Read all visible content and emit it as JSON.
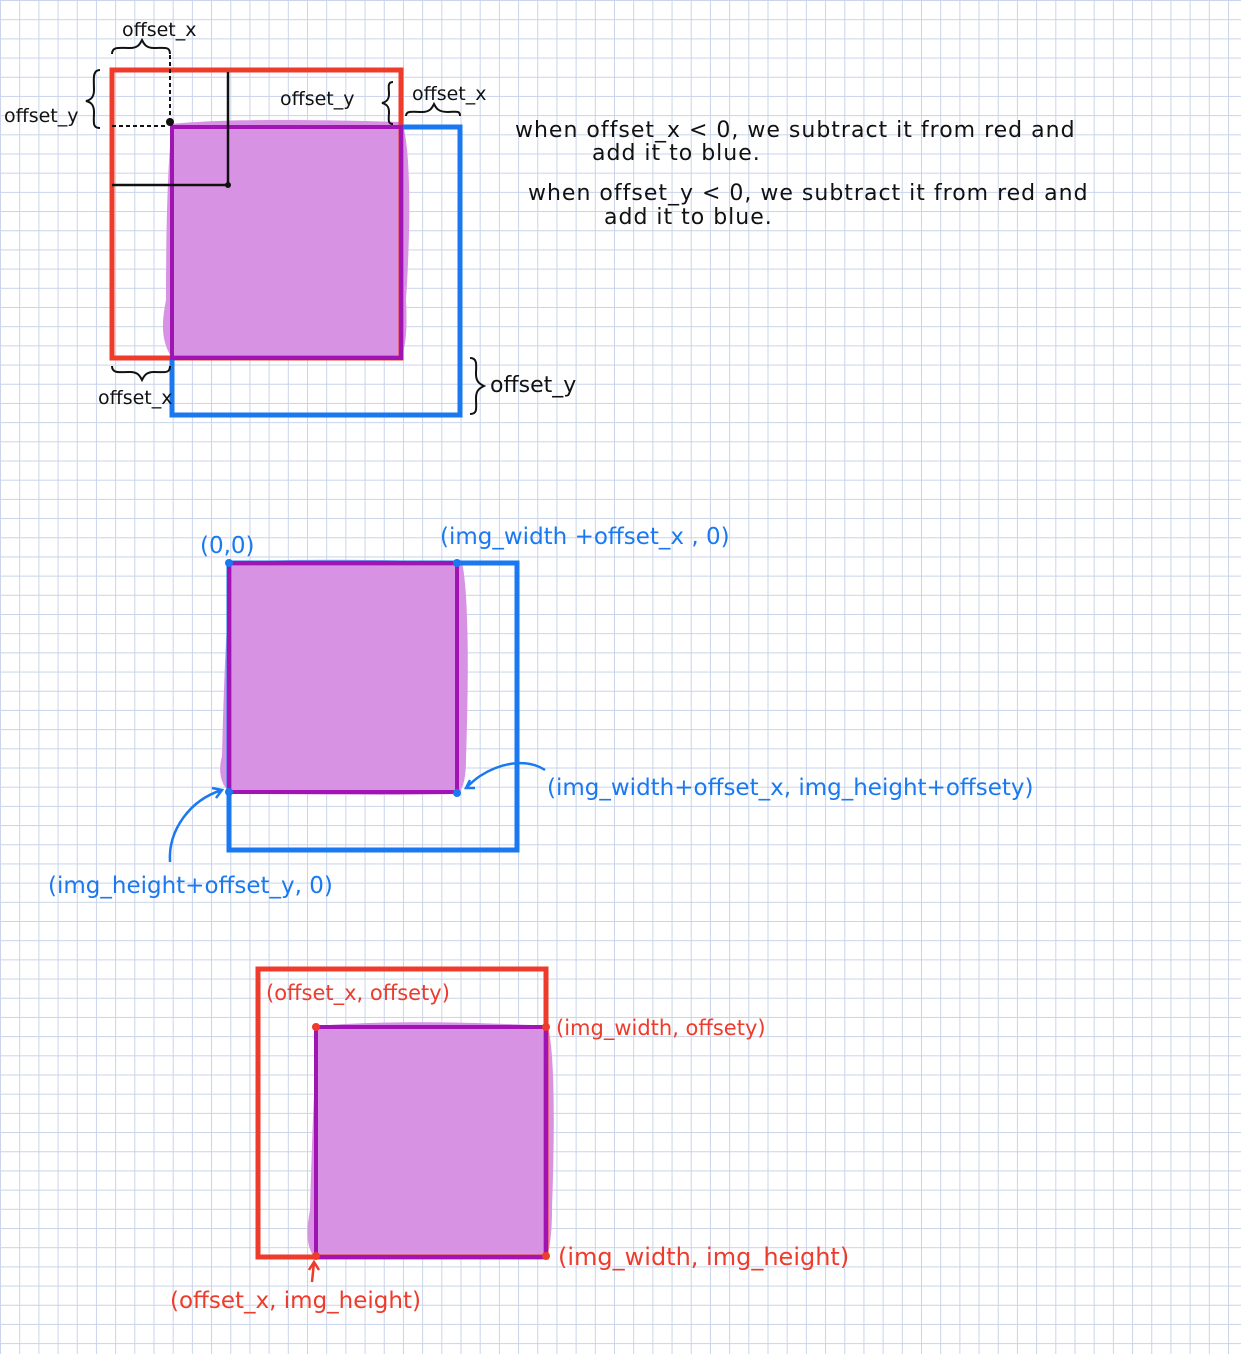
{
  "colors": {
    "red": "#ee3b2b",
    "blue": "#1a79f0",
    "purple_fill": "#d892e4",
    "purple_stroke": "#a014b4",
    "ink": "#111111",
    "grid": "#c9d3ea"
  },
  "diagram1": {
    "label_offset_x_top": "offset_x",
    "label_offset_y_left": "offset_y",
    "label_offset_y_inner": "offset_y",
    "label_offset_x_right": "offset_x",
    "label_offset_x_bottom": "offset_x",
    "label_offset_y_bottom_right": "offset_y"
  },
  "notes": {
    "line1a": "when offset_x < 0, we subtract it from red and",
    "line1b": "add it to blue.",
    "line2a": "when offset_y < 0, we subtract it from red and",
    "line2b": "add it to blue."
  },
  "diagram2": {
    "top_left": "(0,0)",
    "top_right": "(img_width +offset_x , 0)",
    "bottom_right": "(img_width+offset_x, img_height+offsety)",
    "bottom_left": "(img_height+offset_y, 0)"
  },
  "diagram3": {
    "top_left": "(offset_x, offsety)",
    "top_right": "(img_width, offsety)",
    "bottom_right": "(img_width, img_height)",
    "bottom_left": "(offset_x, img_height)"
  }
}
